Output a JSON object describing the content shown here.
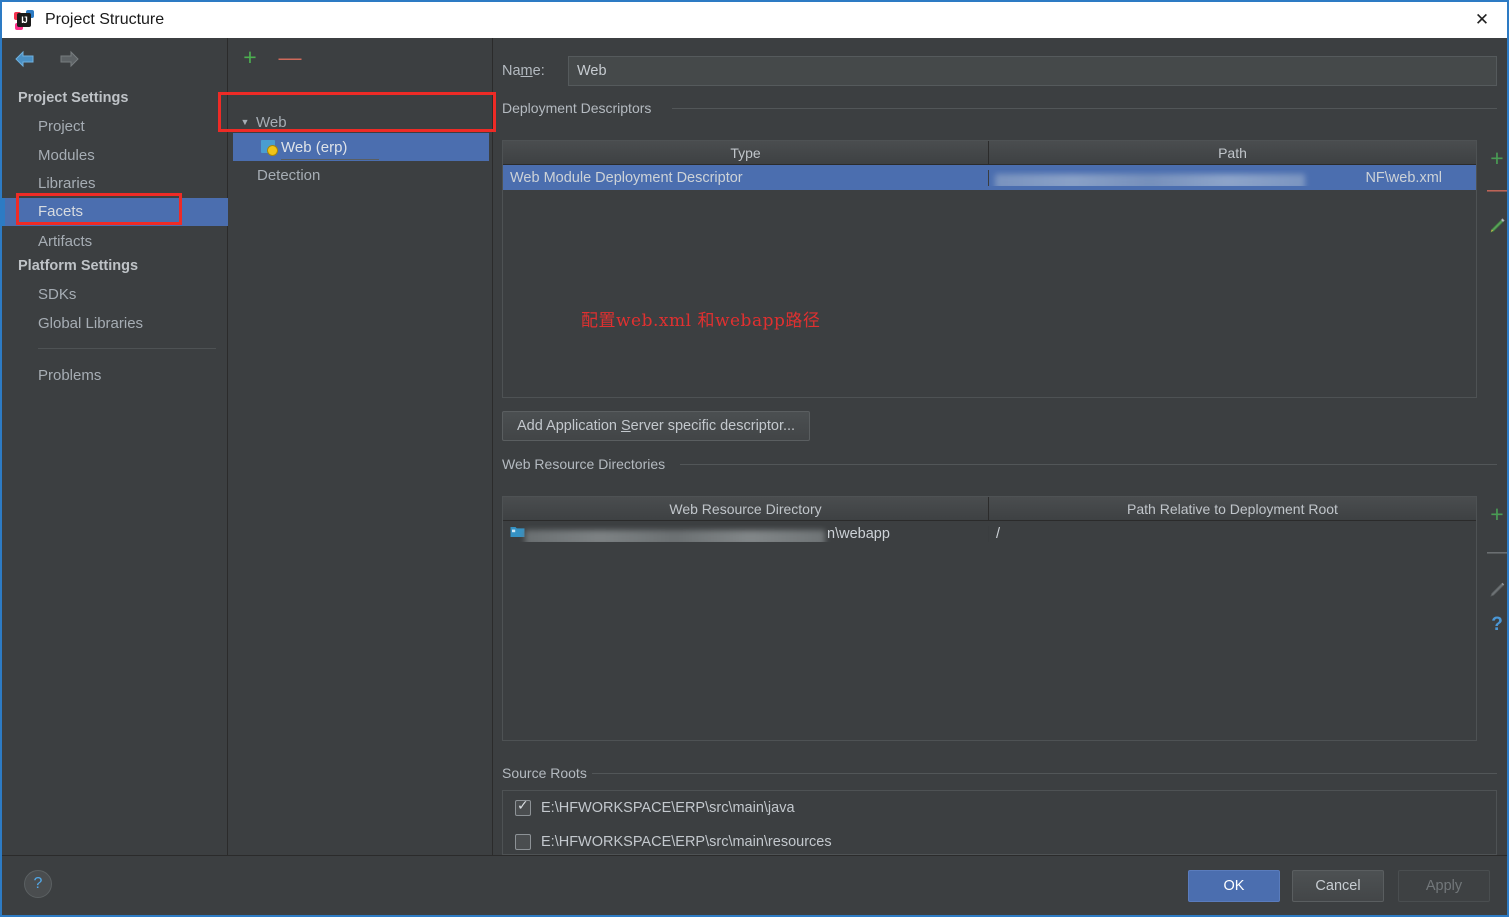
{
  "window": {
    "title": "Project Structure",
    "app_icon": "intellij-idea-icon",
    "icon_text": "IJ",
    "close_label": "✕"
  },
  "nav": {
    "back_icon": "arrow-left-icon",
    "forward_icon": "arrow-right-icon"
  },
  "sidebar": {
    "groups": [
      {
        "label": "Project Settings"
      },
      {
        "label": "Platform Settings"
      }
    ],
    "items": [
      {
        "label": "Project",
        "selected": false
      },
      {
        "label": "Modules",
        "selected": false
      },
      {
        "label": "Libraries",
        "selected": false
      },
      {
        "label": "Facets",
        "selected": true
      },
      {
        "label": "Artifacts",
        "selected": false
      },
      {
        "label": "SDKs",
        "selected": false
      },
      {
        "label": "Global Libraries",
        "selected": false
      },
      {
        "label": "Problems",
        "selected": false
      }
    ]
  },
  "tree_panel": {
    "toolbar": {
      "add_label": "+",
      "remove_label": "—"
    },
    "nodes": [
      {
        "label": "Web",
        "level": 0,
        "expanded": true,
        "selected": false
      },
      {
        "label": "Web (erp)",
        "level": 1,
        "expanded": false,
        "selected": true
      },
      {
        "label": "Detection",
        "level": 0,
        "expanded": false,
        "selected": false
      }
    ]
  },
  "annotation": {
    "text": "配置web.xml 和webapp路径",
    "color": "#e03030"
  },
  "detail": {
    "name_label_pre": "Na",
    "name_label_mnemonic": "m",
    "name_label_post": "e:",
    "name_value": "Web",
    "name_placeholder": "",
    "deployment_descriptors": {
      "title": "Deployment Descriptors",
      "columns": [
        "Type",
        "Path"
      ],
      "rows": [
        {
          "type": "Web Module Deployment Descriptor",
          "path_redacted": true,
          "path_visible_suffix": "NF\\web.xml",
          "selected": true
        }
      ],
      "tools": [
        {
          "name": "add-icon",
          "glyph": "+",
          "state": "enabled"
        },
        {
          "name": "remove-icon",
          "glyph": "—",
          "state": "enabled"
        },
        {
          "name": "edit-icon",
          "glyph": "✎",
          "state": "enabled"
        }
      ]
    },
    "add_descriptor_button": {
      "pre": "Add Application ",
      "mnemonic": "S",
      "post": "erver specific descriptor..."
    },
    "web_resource_directories": {
      "title": "Web Resource Directories",
      "columns": [
        "Web Resource Directory",
        "Path Relative to Deployment Root"
      ],
      "rows": [
        {
          "directory_redacted": true,
          "directory_visible_suffix": "n\\webapp",
          "relative_path": "/",
          "icon": "folder-icon"
        }
      ],
      "tools": [
        {
          "name": "add-icon",
          "glyph": "+",
          "state": "enabled"
        },
        {
          "name": "remove-icon",
          "glyph": "—",
          "state": "disabled"
        },
        {
          "name": "edit-icon",
          "glyph": "✎",
          "state": "disabled"
        },
        {
          "name": "help-icon",
          "glyph": "?",
          "state": "enabled"
        }
      ]
    },
    "source_roots": {
      "title": "Source Roots",
      "items": [
        {
          "label": "E:\\HFWORKSPACE\\ERP\\src\\main\\java",
          "checked": true
        },
        {
          "label": "E:\\HFWORKSPACE\\ERP\\src\\main\\resources",
          "checked": false
        }
      ]
    }
  },
  "footer": {
    "help_label": "?",
    "ok_label": "OK",
    "cancel_label": "Cancel",
    "apply_label": "Apply",
    "apply_disabled": true
  },
  "colors": {
    "window_bg": "#3c3f41",
    "selection_blue": "#4b6eaf",
    "accent_border": "#2d7bc4",
    "annotation_red": "#ee2b26",
    "green_plus": "#4caf50",
    "red_minus": "#cf6a5a"
  }
}
